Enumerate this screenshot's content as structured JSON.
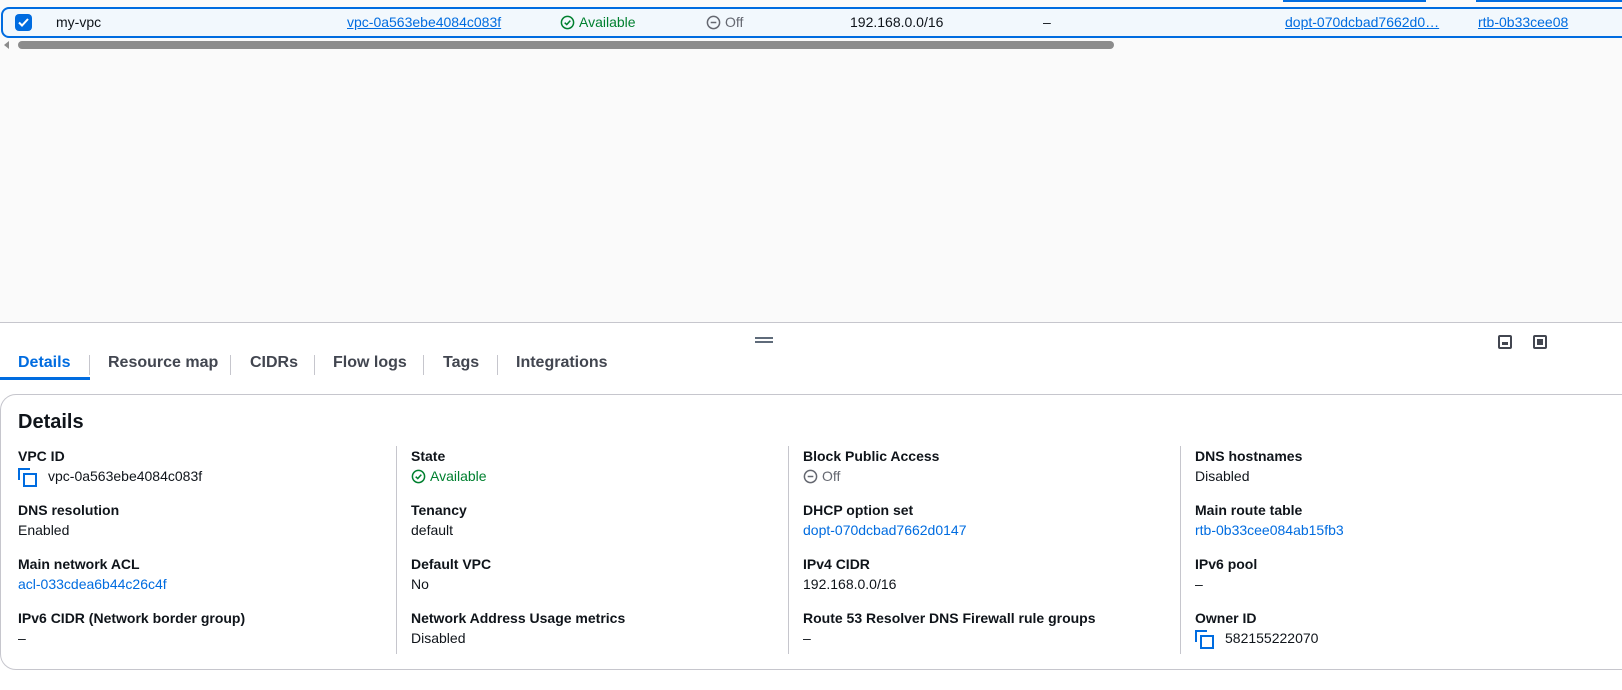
{
  "table": {
    "row": {
      "name": "my-vpc",
      "vpc_id": "vpc-0a563ebe4084c083f",
      "state": "Available",
      "block_public_access": "Off",
      "ipv4_cidr": "192.168.0.0/16",
      "ipv6_cidr": "–",
      "dhcp_option_set": "dopt-070dcbad7662d0…",
      "main_route_table": "rtb-0b33cee08"
    }
  },
  "tabs": [
    {
      "label": "Details"
    },
    {
      "label": "Resource map"
    },
    {
      "label": "CIDRs"
    },
    {
      "label": "Flow logs"
    },
    {
      "label": "Tags"
    },
    {
      "label": "Integrations"
    }
  ],
  "details": {
    "title": "Details",
    "fields": {
      "vpc_id": {
        "label": "VPC ID",
        "value": "vpc-0a563ebe4084c083f"
      },
      "state": {
        "label": "State",
        "value": "Available"
      },
      "block_public_access": {
        "label": "Block Public Access",
        "value": "Off"
      },
      "dns_hostnames": {
        "label": "DNS hostnames",
        "value": "Disabled"
      },
      "dns_resolution": {
        "label": "DNS resolution",
        "value": "Enabled"
      },
      "tenancy": {
        "label": "Tenancy",
        "value": "default"
      },
      "dhcp_option_set": {
        "label": "DHCP option set",
        "value": "dopt-070dcbad7662d0147"
      },
      "main_route_table": {
        "label": "Main route table",
        "value": "rtb-0b33cee084ab15fb3"
      },
      "main_network_acl": {
        "label": "Main network ACL",
        "value": "acl-033cdea6b44c26c4f"
      },
      "default_vpc": {
        "label": "Default VPC",
        "value": "No"
      },
      "ipv4_cidr": {
        "label": "IPv4 CIDR",
        "value": "192.168.0.0/16"
      },
      "ipv6_pool": {
        "label": "IPv6 pool",
        "value": "–"
      },
      "ipv6_cidr_nbg": {
        "label": "IPv6 CIDR (Network border group)",
        "value": "–"
      },
      "nau_metrics": {
        "label": "Network Address Usage metrics",
        "value": "Disabled"
      },
      "route53_firewall": {
        "label": "Route 53 Resolver DNS Firewall rule groups",
        "value": "–"
      },
      "owner_id": {
        "label": "Owner ID",
        "value": "582155222070"
      }
    }
  },
  "colors": {
    "accent": "#006ce0",
    "success": "#00802f",
    "muted": "#656871"
  }
}
